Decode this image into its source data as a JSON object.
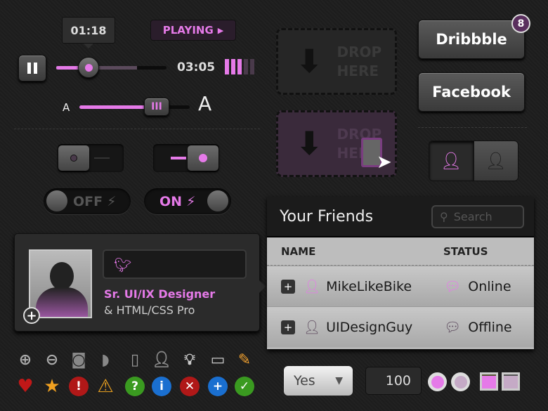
{
  "player": {
    "current_time": "01:18",
    "status": "PLAYING",
    "total_time": "03:05",
    "progress": 0.3,
    "buffered": 0.73,
    "volume_bars": 5,
    "volume_level": 3
  },
  "font_slider": {
    "small_label": "A",
    "large_label": "A",
    "value": 0.62
  },
  "toggles": [
    {
      "state": "off"
    },
    {
      "state": "on"
    }
  ],
  "switches": {
    "off_label": "OFF",
    "on_label": "ON"
  },
  "profile": {
    "title": "Sr. UI/IX Designer",
    "subtitle": "& HTML/CSS Pro",
    "twitter_value": ""
  },
  "icons_row1": [
    "zoom-in-icon",
    "zoom-out-icon",
    "bucket-icon",
    "bucket-tilted-icon",
    "phone-import-icon",
    "add-user-icon",
    "lightbulb-icon",
    "speech-bubble-icon",
    "pencil-icon"
  ],
  "icons_row2": [
    "heart-icon",
    "star-icon",
    "error-icon",
    "warning-icon",
    "help-icon",
    "info-icon",
    "close-icon",
    "add-icon",
    "check-icon"
  ],
  "drop": {
    "label_line1": "DROP",
    "label_line2": "HERE"
  },
  "buttons": {
    "dribbble": "Dribbble",
    "dribbble_badge": "8",
    "facebook": "Facebook"
  },
  "friends": {
    "title": "Your Friends",
    "search_placeholder": "Search",
    "col_name": "NAME",
    "col_status": "STATUS",
    "rows": [
      {
        "name": "MikeLikeBike",
        "status": "Online"
      },
      {
        "name": "UIDesignGuy",
        "status": "Offline"
      }
    ]
  },
  "form": {
    "select_value": "Yes",
    "number_value": "100"
  },
  "colors": {
    "accent": "#e57ae8",
    "background": "#1d1d1d"
  }
}
